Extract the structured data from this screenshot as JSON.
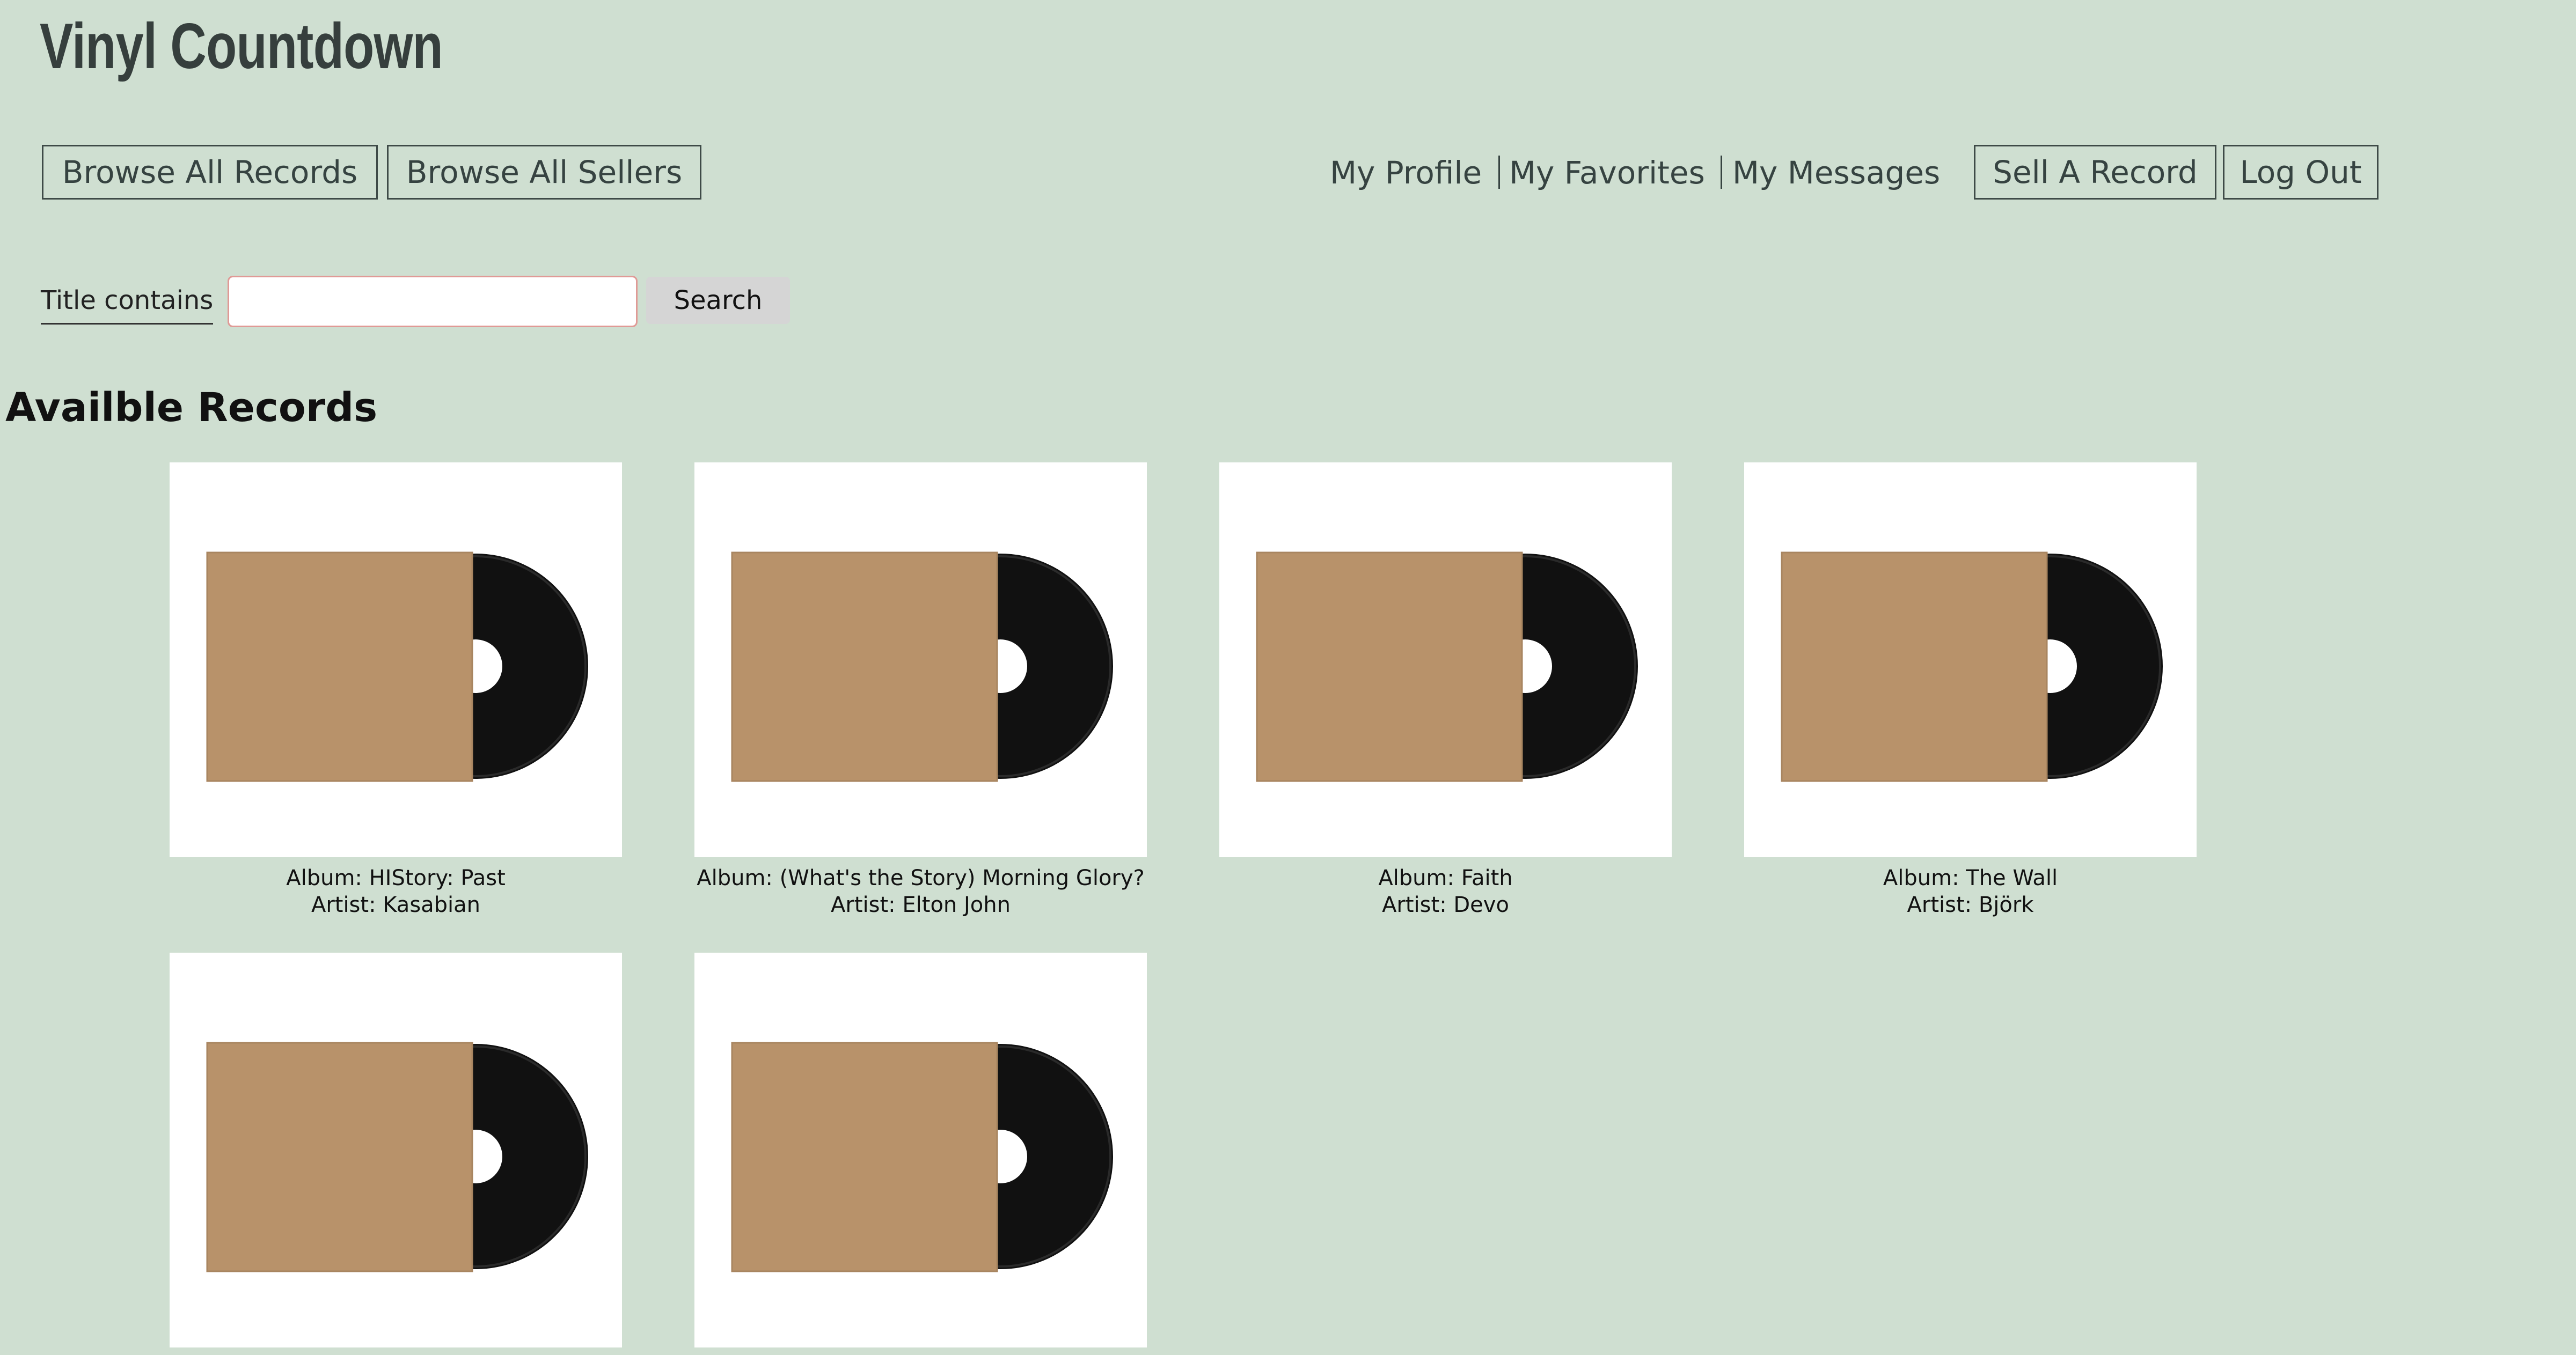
{
  "site": {
    "title": "Vinyl Countdown"
  },
  "nav": {
    "browse_records": "Browse All Records",
    "browse_sellers": "Browse All Sellers",
    "my_profile": "My Profile",
    "my_favorites": "My Favorites",
    "my_messages": "My Messages",
    "sell_record": "Sell A Record",
    "log_out": "Log Out"
  },
  "search": {
    "label": "Title contains",
    "value": "",
    "placeholder": "",
    "button_label": "Search"
  },
  "records_section": {
    "heading": "Availble Records"
  },
  "records": [
    {
      "album": "Album: HIStory: Past",
      "artist": "Artist: Kasabian",
      "image": "vinyl-sleeve-image"
    },
    {
      "album": "Album: (What's the Story) Morning Glory?",
      "artist": "Artist: Elton John",
      "image": "vinyl-sleeve-image"
    },
    {
      "album": "Album: Faith",
      "artist": "Artist: Devo",
      "image": "vinyl-sleeve-image"
    },
    {
      "album": "Album: The Wall",
      "artist": "Artist: Björk",
      "image": "vinyl-sleeve-image"
    },
    {
      "album": "",
      "artist": "",
      "image": "vinyl-sleeve-image"
    },
    {
      "album": "",
      "artist": "",
      "image": "vinyl-sleeve-image"
    }
  ],
  "colors": {
    "background": "#cfdfd1",
    "sleeve": "#b8926a",
    "vinyl": "#111111",
    "input_border": "#e09a96"
  }
}
